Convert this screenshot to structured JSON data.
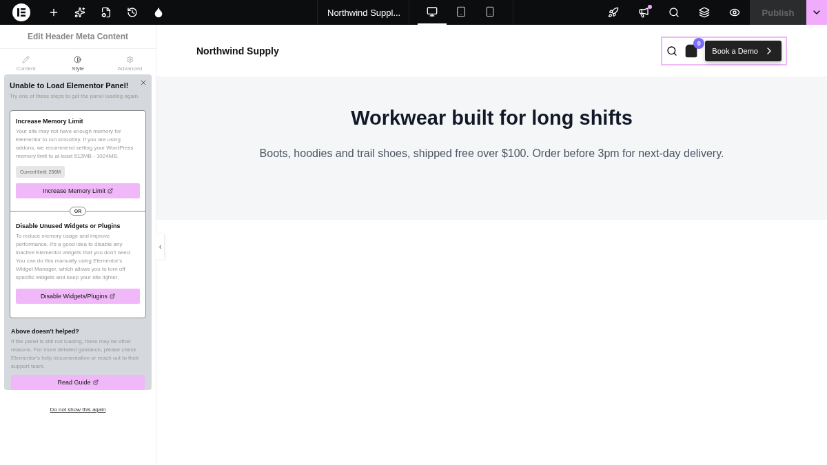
{
  "topbar": {
    "site_title": "Northwind Suppl...",
    "devices": [
      {
        "kind": "desktop",
        "selected": true
      },
      {
        "kind": "tablet",
        "selected": false
      },
      {
        "kind": "mobile",
        "selected": false
      }
    ],
    "notification_dot": true,
    "publish": {
      "label": "Publish",
      "disabled": true
    }
  },
  "panel": {
    "title": "Edit Header Meta Content",
    "tabs": [
      {
        "kind": "content",
        "label": "Content",
        "selected": false
      },
      {
        "kind": "style",
        "label": "Style",
        "selected": true
      },
      {
        "kind": "advanced",
        "label": "Advanced",
        "selected": false
      }
    ]
  },
  "dialog": {
    "title": "Unable to Load Elementor Panel!",
    "subtitle": "Try one of these steps to get the panel loading again.",
    "divider": "OR",
    "steps": [
      {
        "title": "Increase Memory Limit",
        "text": "Your site may not have enough memory for Elementor to run smoothly. If you are using addons, we recommend setting your WordPress memory limit to at least 512MB - 1024MB.",
        "chip": "Current limit: 256M",
        "button": "Increase Memory Limit"
      },
      {
        "title": "Disable Unused Widgets or Plugins",
        "text": "To reduce memory usage and improve performance, it's a good idea to disable any inactive Elementor widgets that you don't need. You can do this manually using Elementor's Widget Manager, which allows you to turn off specific widgets and keep your site lighter.",
        "button": "Disable Widgets/Plugins"
      }
    ],
    "help_title": "Above doesn't helped?",
    "help_text": "If the panel is still not loading, there may be other reasons. For more detailed guidance, please check Elementor's help documentation or reach out to their support team.",
    "help_button": "Read Guide",
    "dismiss": "Do not show this again"
  },
  "site": {
    "brand": "Northwind Supply",
    "cart_count": "0",
    "cta": "Book a Demo",
    "hero_title": "Workwear built for long shifts",
    "hero_text": "Boots, hoodies and trail shoes, shipped free over $100. Order before 3pm for next-day delivery."
  }
}
